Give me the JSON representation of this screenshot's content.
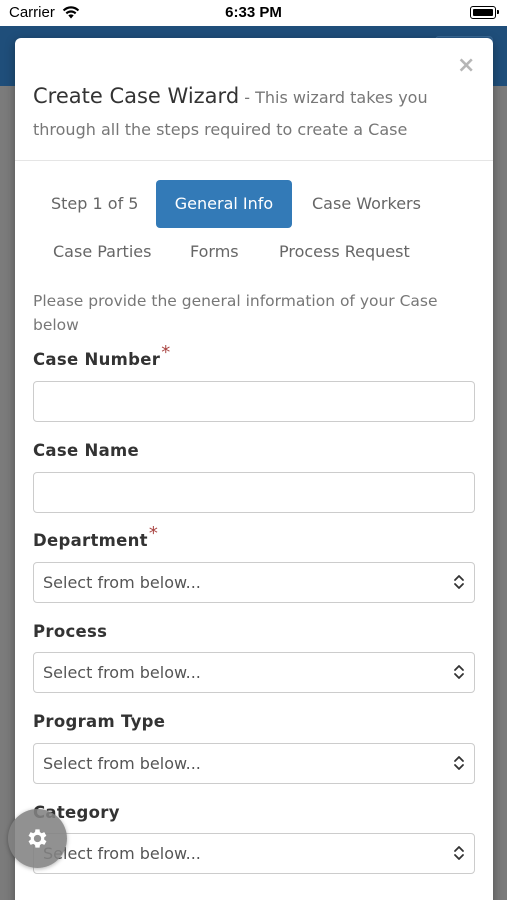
{
  "status_bar": {
    "carrier": "Carrier",
    "time": "6:33 PM",
    "wifi_icon": "wifi-icon",
    "battery_icon": "battery-full-icon"
  },
  "modal": {
    "title": "Create Case Wizard",
    "subtitle": " - This wizard takes you through all the steps required to create a Case",
    "close_symbol": "×"
  },
  "steps": {
    "indicator": "Step 1 of 5",
    "items": [
      {
        "label": "General Info",
        "active": true
      },
      {
        "label": "Case Workers",
        "active": false
      },
      {
        "label": "Case Parties",
        "active": false
      },
      {
        "label": "Forms",
        "active": false
      },
      {
        "label": "Process Request",
        "active": false
      }
    ]
  },
  "intro": "Please provide the general information of your Case below",
  "form": {
    "case_number": {
      "label": "Case Number",
      "required": "*",
      "value": ""
    },
    "case_name": {
      "label": "Case Name",
      "value": ""
    },
    "department": {
      "label": "Department",
      "required": "*",
      "selected": "Select from below..."
    },
    "process": {
      "label": "Process",
      "selected": "Select from below..."
    },
    "program_type": {
      "label": "Program Type",
      "selected": "Select from below..."
    },
    "category": {
      "label": "Category",
      "selected": "Select from below..."
    }
  },
  "colors": {
    "primary": "#337ab7",
    "header_bg": "#1f4e7a",
    "required": "#a94442"
  },
  "fab_icon": "gear-icon"
}
